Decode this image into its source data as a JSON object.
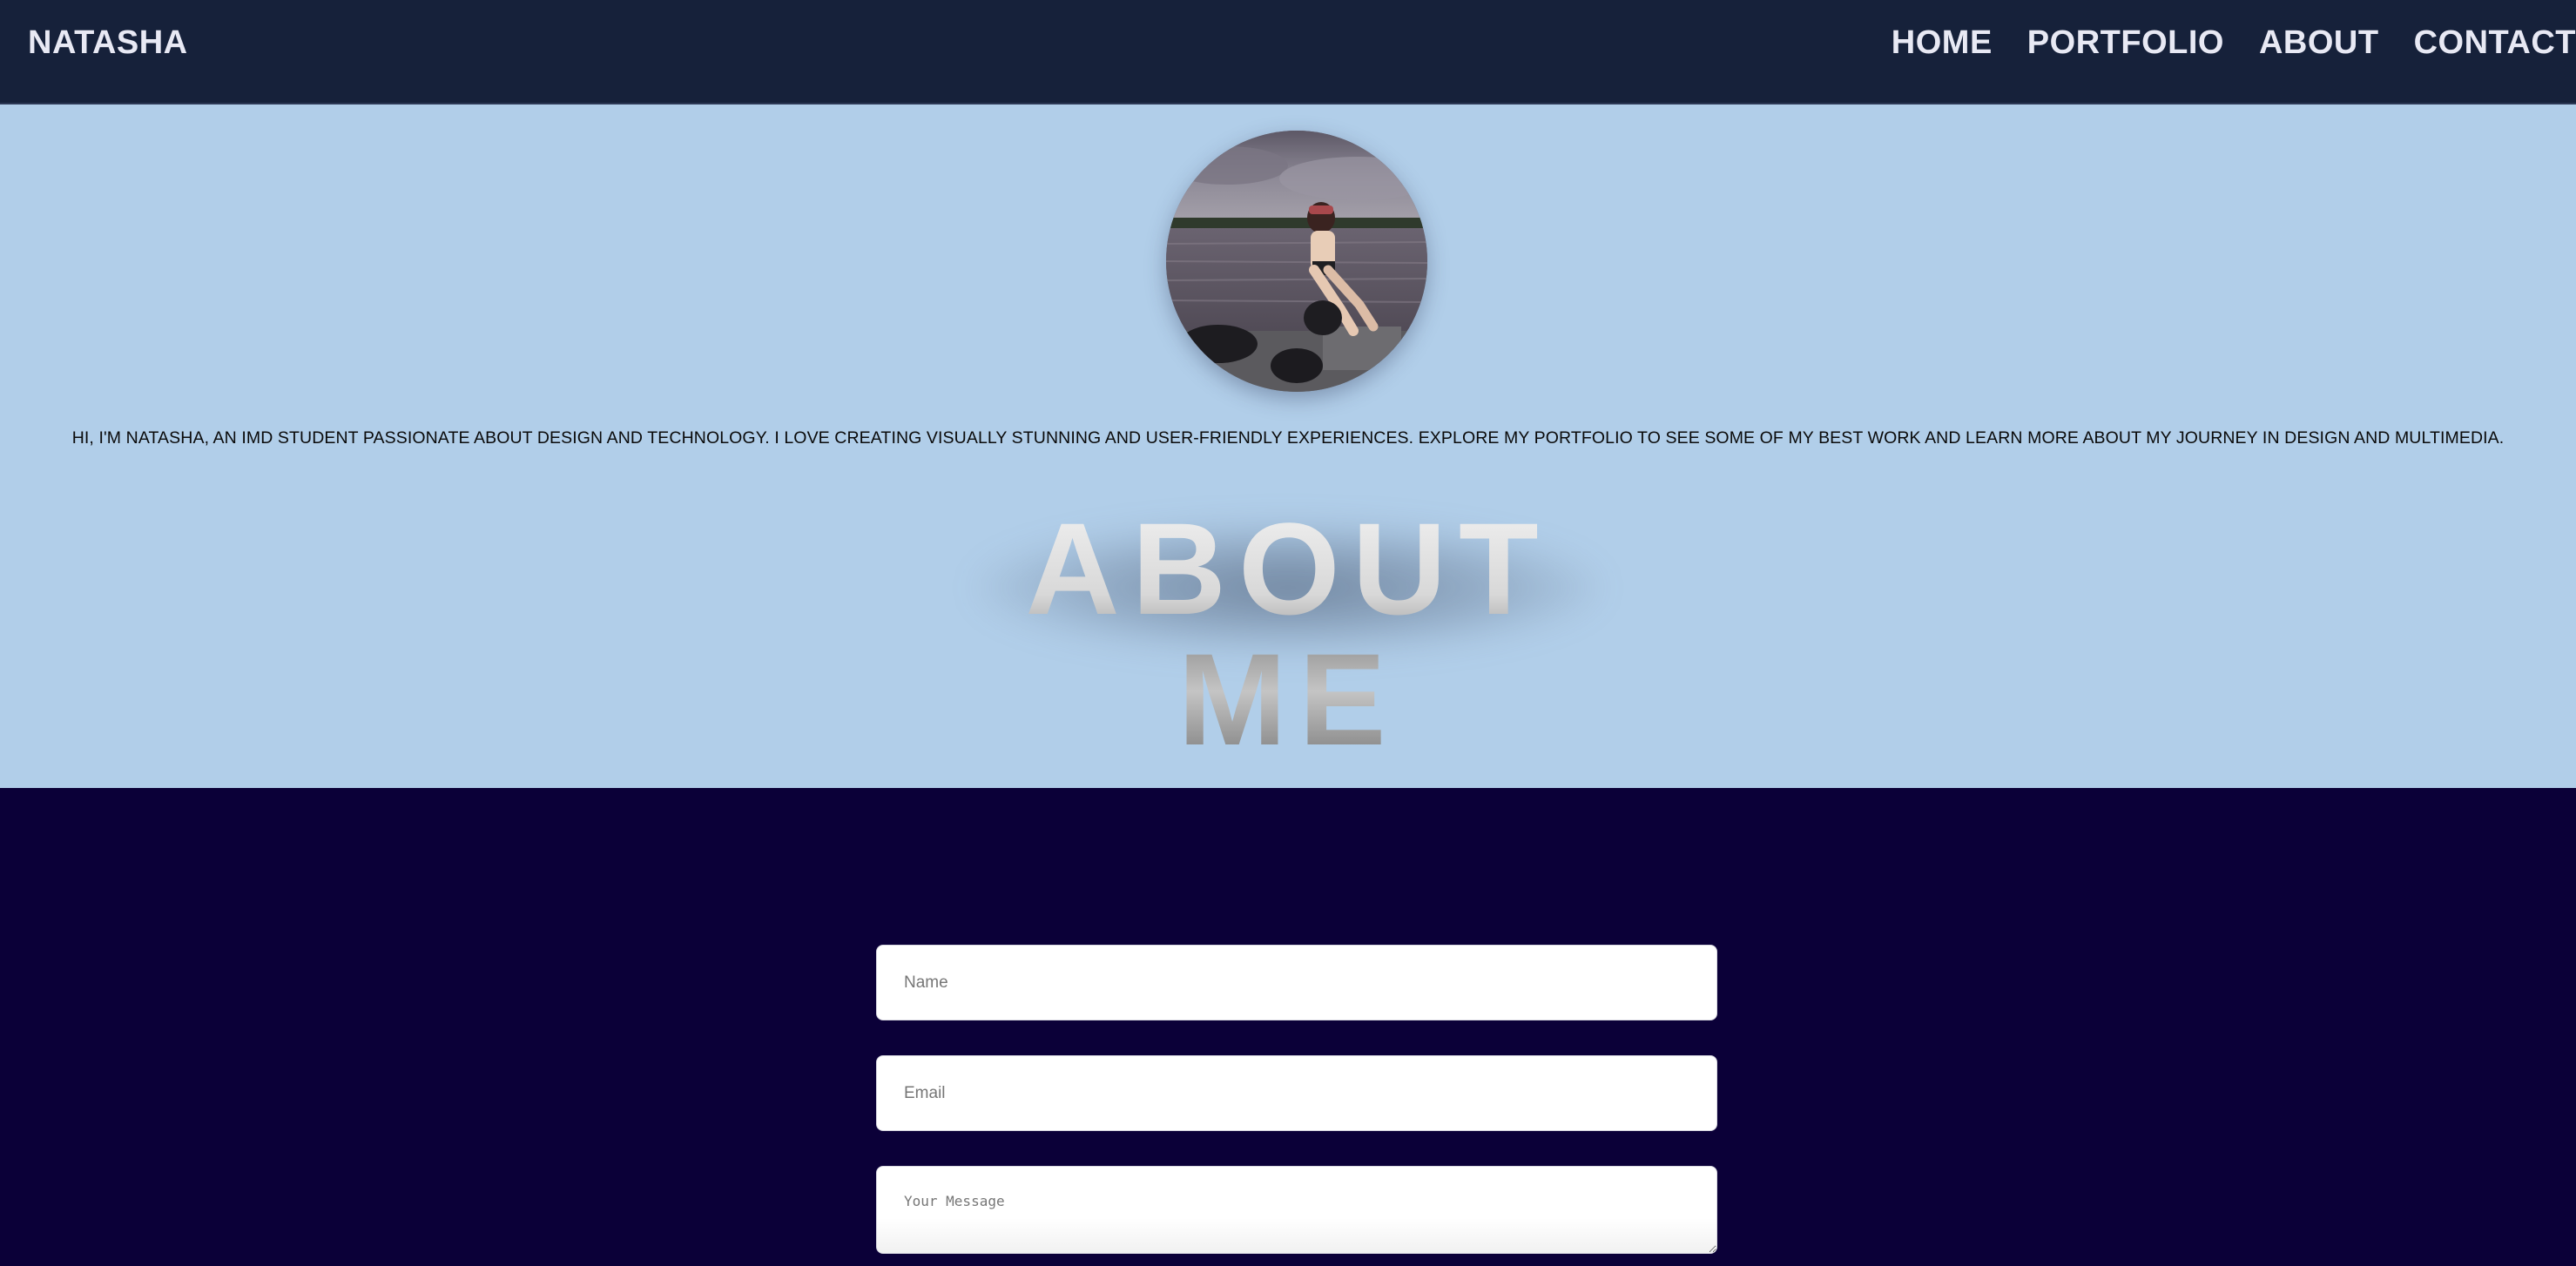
{
  "header": {
    "brand": "NATASHA",
    "nav": [
      {
        "label": "HOME"
      },
      {
        "label": "PORTFOLIO"
      },
      {
        "label": "ABOUT"
      },
      {
        "label": "CONTACT"
      }
    ]
  },
  "about": {
    "avatar_icon": "profile-photo",
    "intro": "HI, I'M NATASHA, AN IMD STUDENT PASSIONATE ABOUT DESIGN AND TECHNOLOGY. I LOVE CREATING VISUALLY STUNNING AND USER-FRIENDLY EXPERIENCES. EXPLORE MY PORTFOLIO TO SEE SOME OF MY BEST WORK AND LEARN MORE ABOUT MY JOURNEY IN DESIGN AND MULTIMEDIA.",
    "title": "ABOUT ME"
  },
  "contact": {
    "name_placeholder": "Name",
    "email_placeholder": "Email",
    "message_placeholder": "Your Message"
  },
  "colors": {
    "header_bg": "#16213a",
    "about_bg": "#b1cee9",
    "contact_bg": "#0b0038",
    "nav_text": "#e8e9f4"
  }
}
